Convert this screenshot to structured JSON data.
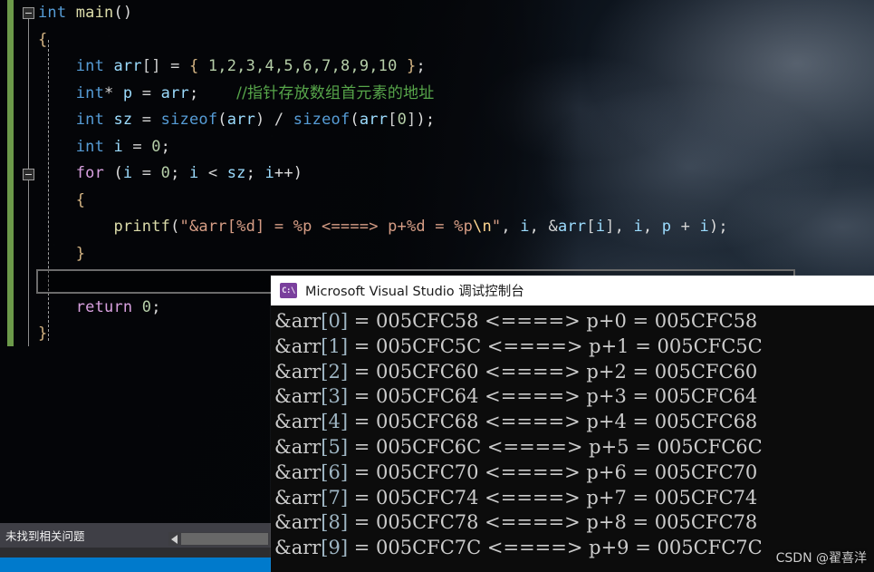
{
  "editor": {
    "background_description": "earth-from-space-photo",
    "change_bar_color": "#6c9a4a",
    "code_lines": [
      {
        "id": "l1",
        "tokens": [
          {
            "t": "int",
            "c": "kw"
          },
          {
            "t": " ",
            "c": "op"
          },
          {
            "t": "main",
            "c": "fn"
          },
          {
            "t": "()",
            "c": "punc"
          }
        ]
      },
      {
        "id": "l2",
        "tokens": [
          {
            "t": "{",
            "c": "brace"
          }
        ]
      },
      {
        "id": "l3",
        "tokens": [
          {
            "t": "    int",
            "c": "kw"
          },
          {
            "t": " ",
            "c": "op"
          },
          {
            "t": "arr",
            "c": "var"
          },
          {
            "t": "[]",
            "c": "brkt"
          },
          {
            "t": " = ",
            "c": "op"
          },
          {
            "t": "{",
            "c": "brace"
          },
          {
            "t": " ",
            "c": "op"
          },
          {
            "t": "1,2,3,4,5,6,7,8,9,10",
            "c": "num"
          },
          {
            "t": " ",
            "c": "op"
          },
          {
            "t": "}",
            "c": "brace"
          },
          {
            "t": ";",
            "c": "punc"
          }
        ]
      },
      {
        "id": "l4",
        "tokens": [
          {
            "t": "    int",
            "c": "kw"
          },
          {
            "t": "* ",
            "c": "op"
          },
          {
            "t": "p",
            "c": "var"
          },
          {
            "t": " = ",
            "c": "op"
          },
          {
            "t": "arr",
            "c": "var"
          },
          {
            "t": ";",
            "c": "punc"
          },
          {
            "t": "    ",
            "c": "op"
          },
          {
            "t": "//指针存放数组首元素的地址",
            "c": "cmt"
          }
        ]
      },
      {
        "id": "l5",
        "tokens": [
          {
            "t": "    int",
            "c": "kw"
          },
          {
            "t": " ",
            "c": "op"
          },
          {
            "t": "sz",
            "c": "var"
          },
          {
            "t": " = ",
            "c": "op"
          },
          {
            "t": "sizeof",
            "c": "kw"
          },
          {
            "t": "(",
            "c": "punc"
          },
          {
            "t": "arr",
            "c": "var"
          },
          {
            "t": ") / ",
            "c": "op"
          },
          {
            "t": "sizeof",
            "c": "kw"
          },
          {
            "t": "(",
            "c": "punc"
          },
          {
            "t": "arr",
            "c": "var"
          },
          {
            "t": "[",
            "c": "brkt"
          },
          {
            "t": "0",
            "c": "num"
          },
          {
            "t": "]",
            "c": "brkt"
          },
          {
            "t": ");",
            "c": "punc"
          }
        ]
      },
      {
        "id": "l6",
        "tokens": [
          {
            "t": "    int",
            "c": "kw"
          },
          {
            "t": " ",
            "c": "op"
          },
          {
            "t": "i",
            "c": "var"
          },
          {
            "t": " = ",
            "c": "op"
          },
          {
            "t": "0",
            "c": "num"
          },
          {
            "t": ";",
            "c": "punc"
          }
        ]
      },
      {
        "id": "l7",
        "tokens": [
          {
            "t": "    for",
            "c": "ctl"
          },
          {
            "t": " (",
            "c": "punc"
          },
          {
            "t": "i",
            "c": "var"
          },
          {
            "t": " = ",
            "c": "op"
          },
          {
            "t": "0",
            "c": "num"
          },
          {
            "t": "; ",
            "c": "punc"
          },
          {
            "t": "i",
            "c": "var"
          },
          {
            "t": " < ",
            "c": "op"
          },
          {
            "t": "sz",
            "c": "var"
          },
          {
            "t": "; ",
            "c": "punc"
          },
          {
            "t": "i",
            "c": "var"
          },
          {
            "t": "++)",
            "c": "punc"
          }
        ]
      },
      {
        "id": "l8",
        "tokens": [
          {
            "t": "    {",
            "c": "brace"
          }
        ]
      },
      {
        "id": "l9",
        "tokens": [
          {
            "t": "        printf",
            "c": "fn"
          },
          {
            "t": "(",
            "c": "punc"
          },
          {
            "t": "\"&arr[%d] = %p <====> p+%d = %p",
            "c": "str"
          },
          {
            "t": "\\n",
            "c": "esc"
          },
          {
            "t": "\"",
            "c": "str"
          },
          {
            "t": ", ",
            "c": "punc"
          },
          {
            "t": "i",
            "c": "var"
          },
          {
            "t": ", ",
            "c": "punc"
          },
          {
            "t": "&",
            "c": "op"
          },
          {
            "t": "arr",
            "c": "var"
          },
          {
            "t": "[",
            "c": "brkt"
          },
          {
            "t": "i",
            "c": "var"
          },
          {
            "t": "]",
            "c": "brkt"
          },
          {
            "t": ", ",
            "c": "punc"
          },
          {
            "t": "i",
            "c": "var"
          },
          {
            "t": ", ",
            "c": "punc"
          },
          {
            "t": "p",
            "c": "var"
          },
          {
            "t": " + ",
            "c": "op"
          },
          {
            "t": "i",
            "c": "var"
          },
          {
            "t": ");",
            "c": "punc"
          }
        ]
      },
      {
        "id": "l10",
        "tokens": [
          {
            "t": "    }",
            "c": "brace"
          }
        ]
      },
      {
        "id": "l11",
        "tokens": [
          {
            "t": "",
            "c": "op"
          }
        ]
      },
      {
        "id": "l12",
        "tokens": [
          {
            "t": "    return",
            "c": "ctl"
          },
          {
            "t": " ",
            "c": "op"
          },
          {
            "t": "0",
            "c": "num"
          },
          {
            "t": ";",
            "c": "punc"
          }
        ]
      },
      {
        "id": "l13",
        "tokens": [
          {
            "t": "}",
            "c": "brace"
          }
        ]
      }
    ]
  },
  "error_list": {
    "status_text": "未找到相关问题"
  },
  "console": {
    "title": "Microsoft Visual Studio 调试控制台",
    "icon": "console-cmd-icon",
    "lines": [
      {
        "label": "&arr[0]",
        "index": "0",
        "addr_left": "005CFC58",
        "arrow": "<====>",
        "ptr": "p+0",
        "addr_right": "005CFC58"
      },
      {
        "label": "&arr[1]",
        "index": "1",
        "addr_left": "005CFC5C",
        "arrow": "<====>",
        "ptr": "p+1",
        "addr_right": "005CFC5C"
      },
      {
        "label": "&arr[2]",
        "index": "2",
        "addr_left": "005CFC60",
        "arrow": "<====>",
        "ptr": "p+2",
        "addr_right": "005CFC60"
      },
      {
        "label": "&arr[3]",
        "index": "3",
        "addr_left": "005CFC64",
        "arrow": "<====>",
        "ptr": "p+3",
        "addr_right": "005CFC64"
      },
      {
        "label": "&arr[4]",
        "index": "4",
        "addr_left": "005CFC68",
        "arrow": "<====>",
        "ptr": "p+4",
        "addr_right": "005CFC68"
      },
      {
        "label": "&arr[5]",
        "index": "5",
        "addr_left": "005CFC6C",
        "arrow": "<====>",
        "ptr": "p+5",
        "addr_right": "005CFC6C"
      },
      {
        "label": "&arr[6]",
        "index": "6",
        "addr_left": "005CFC70",
        "arrow": "<====>",
        "ptr": "p+6",
        "addr_right": "005CFC70"
      },
      {
        "label": "&arr[7]",
        "index": "7",
        "addr_left": "005CFC74",
        "arrow": "<====>",
        "ptr": "p+7",
        "addr_right": "005CFC74"
      },
      {
        "label": "&arr[8]",
        "index": "8",
        "addr_left": "005CFC78",
        "arrow": "<====>",
        "ptr": "p+8",
        "addr_right": "005CFC78"
      },
      {
        "label": "&arr[9]",
        "index": "9",
        "addr_left": "005CFC7C",
        "arrow": "<====>",
        "ptr": "p+9",
        "addr_right": "005CFC7C"
      }
    ]
  },
  "watermark": {
    "text": "CSDN @翟喜洋"
  }
}
